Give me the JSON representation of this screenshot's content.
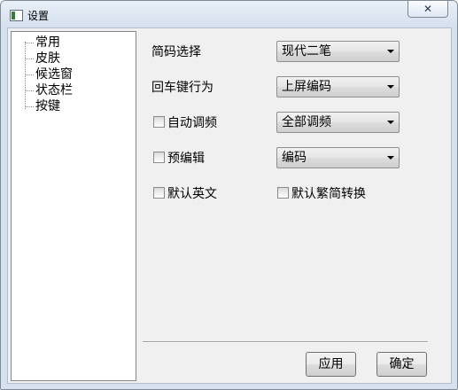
{
  "window": {
    "title": "设置",
    "close_glyph": "✕"
  },
  "tree": {
    "items": [
      {
        "label": "常用"
      },
      {
        "label": "皮肤"
      },
      {
        "label": "候选窗"
      },
      {
        "label": "状态栏"
      },
      {
        "label": "按键"
      }
    ]
  },
  "settings": {
    "short_code": {
      "label": "简码选择",
      "value": "现代二笔"
    },
    "enter_key": {
      "label": "回车键行为",
      "value": "上屏编码"
    },
    "auto_freq": {
      "label": "自动调频",
      "checked": false,
      "value": "全部调频"
    },
    "pre_edit": {
      "label": "预编辑",
      "checked": false,
      "value": "编码"
    },
    "default_english": {
      "label": "默认英文",
      "checked": false
    },
    "default_trad": {
      "label": "默认繁简转换",
      "checked": false
    }
  },
  "buttons": {
    "apply": "应用",
    "ok": "确定"
  }
}
